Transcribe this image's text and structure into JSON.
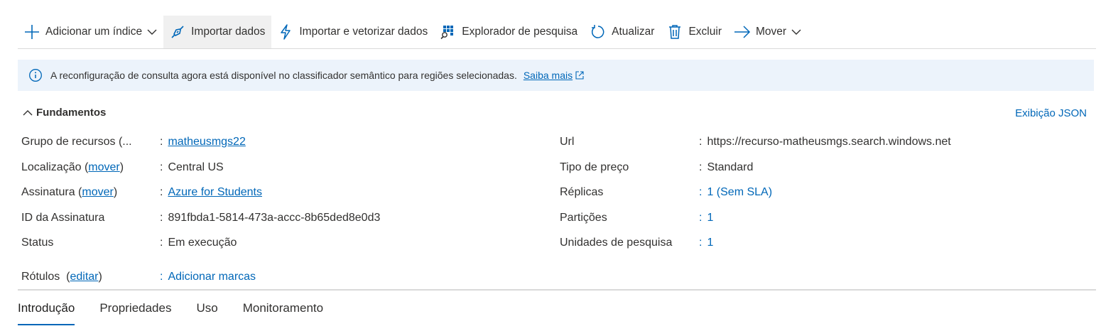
{
  "toolbar": {
    "add_index": "Adicionar um índice",
    "import_data": "Importar dados",
    "import_vectorize": "Importar e vetorizar dados",
    "search_explorer": "Explorador de pesquisa",
    "refresh": "Atualizar",
    "delete": "Excluir",
    "move": "Mover"
  },
  "info_banner": {
    "message": "A reconfiguração de consulta agora está disponível no classificador semântico para regiões selecionadas.",
    "link": "Saiba mais"
  },
  "essentials": {
    "title": "Fundamentos",
    "json_view": "Exibição JSON",
    "left": {
      "resource_group_label": "Grupo de recursos (...",
      "resource_group_value": "matheusmgs22",
      "location_label_prefix": "Localização (",
      "location_label_link": "mover",
      "location_label_suffix": ")",
      "location_value": "Central US",
      "subscription_label_prefix": "Assinatura (",
      "subscription_label_link": "mover",
      "subscription_label_suffix": ")",
      "subscription_value": "Azure for Students",
      "subscription_id_label": "ID da Assinatura",
      "subscription_id_value": "891fbda1-5814-473a-accc-8b65ded8e0d3",
      "status_label": "Status",
      "status_value": "Em execução",
      "tags_label_prefix": "Rótulos  (",
      "tags_label_link": "editar",
      "tags_label_suffix": ")",
      "tags_value": "Adicionar marcas"
    },
    "right": {
      "url_label": "Url",
      "url_value": "https://recurso-matheusmgs.search.windows.net",
      "pricing_label": "Tipo de preço",
      "pricing_value": "Standard",
      "replicas_label": "Réplicas",
      "replicas_value": "1 (Sem SLA)",
      "partitions_label": "Partições",
      "partitions_value": "1",
      "search_units_label": "Unidades de pesquisa",
      "search_units_value": "1"
    }
  },
  "tabs": [
    "Introdução",
    "Propriedades",
    "Uso",
    "Monitoramento"
  ],
  "colors": {
    "accent": "#0067b8",
    "banner_bg": "#ecf3fb"
  }
}
